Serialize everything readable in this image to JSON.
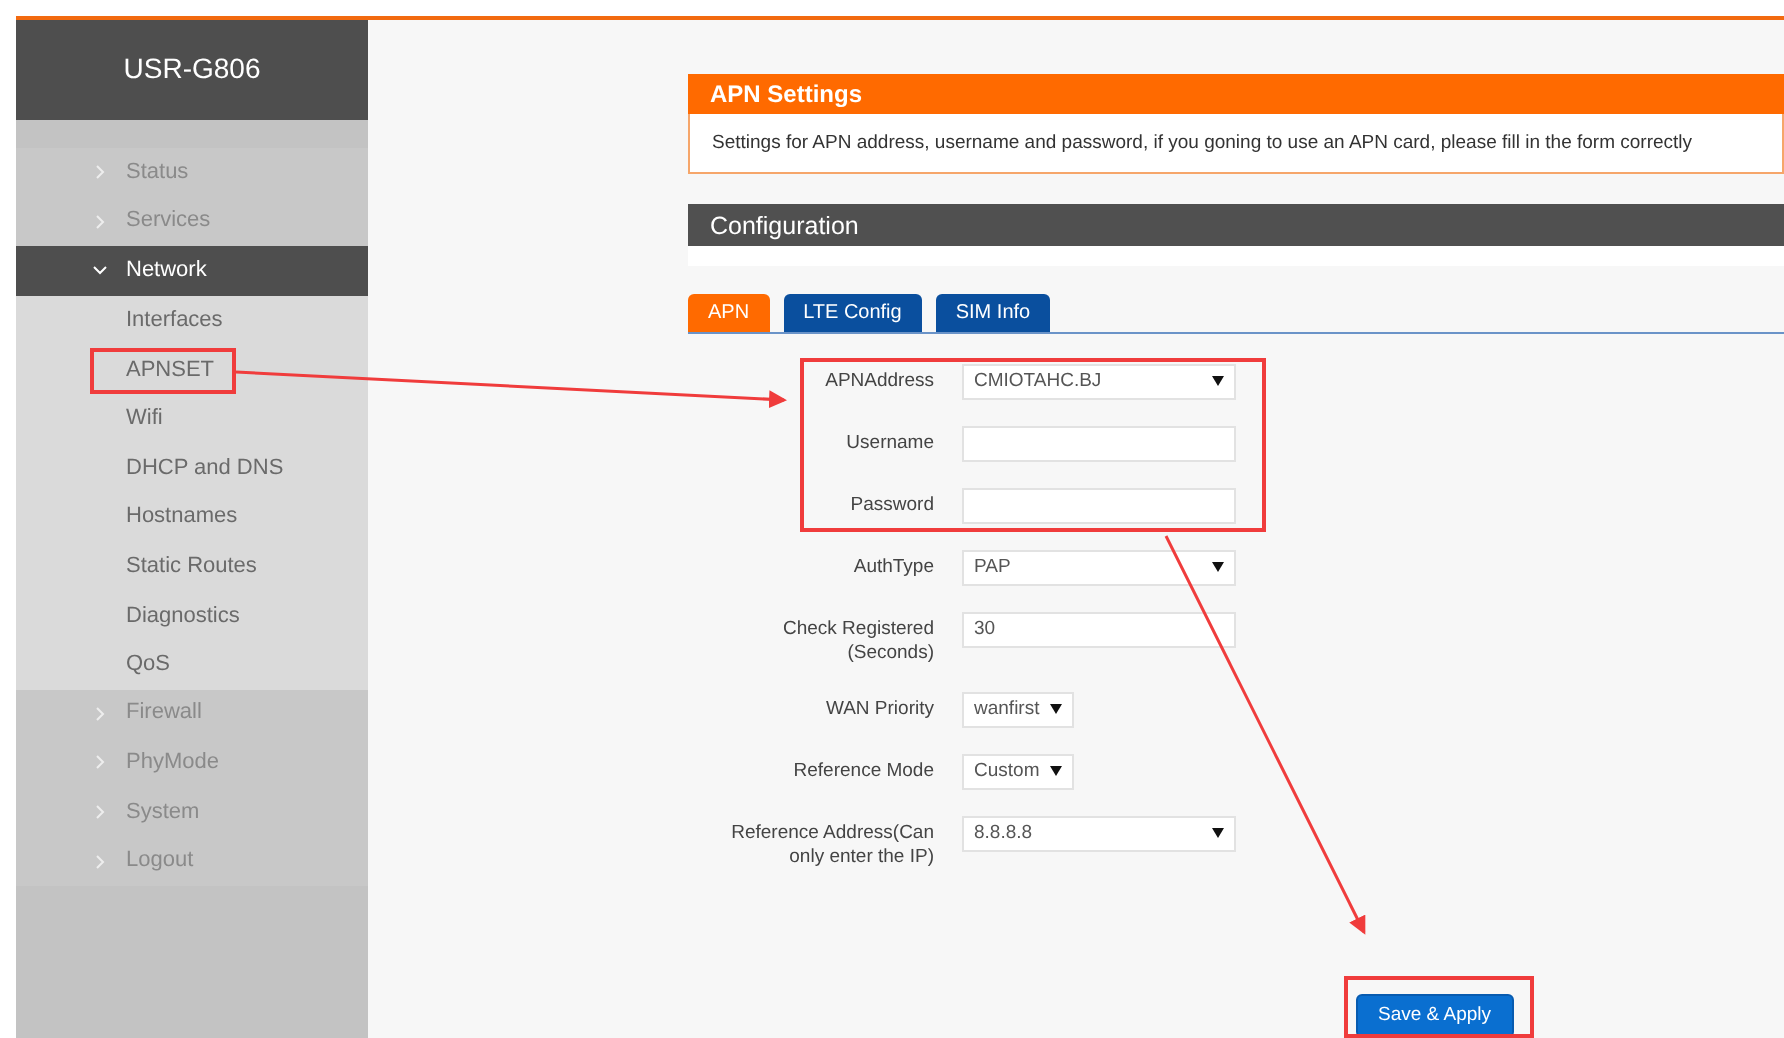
{
  "sidebar": {
    "title": "USR-G806",
    "items": [
      {
        "label": "Status",
        "expanded": false
      },
      {
        "label": "Services",
        "expanded": false
      },
      {
        "label": "Network",
        "expanded": true,
        "children": [
          {
            "label": "Interfaces"
          },
          {
            "label": "APNSET"
          },
          {
            "label": "Wifi"
          },
          {
            "label": "DHCP and DNS"
          },
          {
            "label": "Hostnames"
          },
          {
            "label": "Static Routes"
          },
          {
            "label": "Diagnostics"
          },
          {
            "label": "QoS"
          }
        ]
      },
      {
        "label": "Firewall",
        "expanded": false
      },
      {
        "label": "PhyMode",
        "expanded": false
      },
      {
        "label": "System",
        "expanded": false
      },
      {
        "label": "Logout",
        "expanded": false
      }
    ]
  },
  "apn_settings": {
    "title": "APN Settings",
    "description": "Settings for APN address, username and password, if you goning to use an APN card, please fill in the form correctly"
  },
  "configuration": {
    "title": "Configuration"
  },
  "tabs": [
    {
      "label": "APN",
      "selected": true
    },
    {
      "label": "LTE Config",
      "selected": false
    },
    {
      "label": "SIM Info",
      "selected": false
    }
  ],
  "form": [
    {
      "label": "APNAddress",
      "kind": "select",
      "value": "CMIOTAHC.BJ"
    },
    {
      "label": "Username",
      "kind": "input"
    },
    {
      "label": "Password",
      "kind": "input"
    },
    {
      "label": "AuthType",
      "kind": "select",
      "value": "PAP"
    },
    {
      "label": "Check Registered (Seconds)",
      "kind": "input",
      "value": "30"
    },
    {
      "label": "WAN Priority",
      "kind": "smallselect",
      "value": "wanfirst"
    },
    {
      "label": "Reference Mode",
      "kind": "smallselect",
      "value": "Custom"
    },
    {
      "label": "Reference Address(Can only enter the IP)",
      "kind": "select",
      "value": "8.8.8.8"
    }
  ],
  "save_button": "Save & Apply"
}
